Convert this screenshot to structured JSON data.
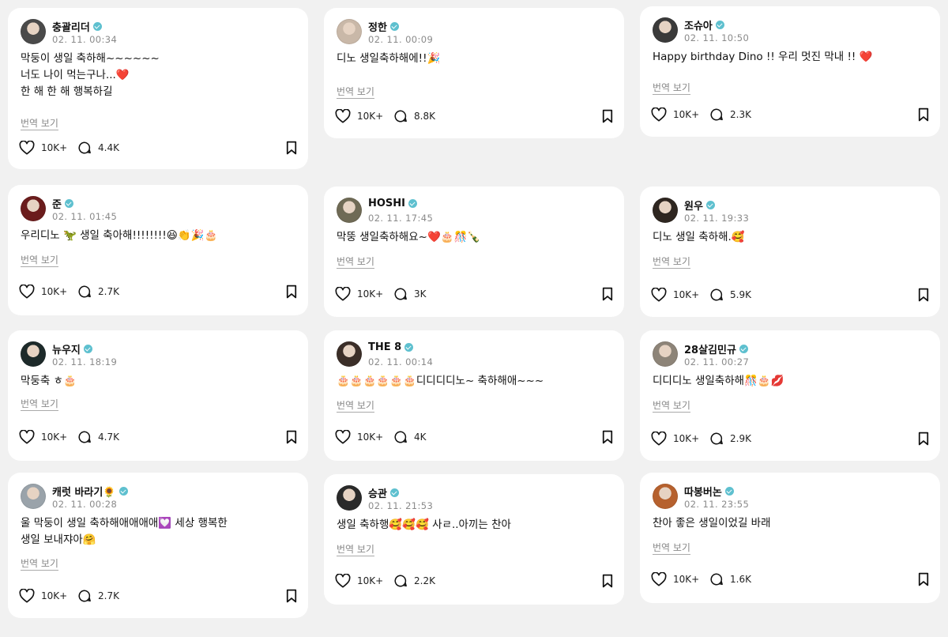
{
  "translate_label": "번역 보기",
  "accent_color": "#5ec0cf",
  "posts": [
    {
      "name": "충괄리더",
      "date": "02. 11. 00:34",
      "lines": [
        "막둥이 생일 축하해~~~~~~",
        "너도 나이 먹는구나...❤️",
        "한 해 한 해 행복하길"
      ],
      "likes": "10K+",
      "replies": "4.4K",
      "avatar": "#4a4a4a"
    },
    {
      "name": "정한",
      "date": "02. 11. 00:09",
      "lines": [
        "디노 생일축하해에!!🎉"
      ],
      "likes": "10K+",
      "replies": "8.8K",
      "avatar": "#c9b8a8"
    },
    {
      "name": "조슈아",
      "date": "02. 11. 10:50",
      "lines": [
        "Happy birthday Dino !! 우리 멋진 막내 !! ❤️"
      ],
      "likes": "10K+",
      "replies": "2.3K",
      "avatar": "#3a3a3a"
    },
    {
      "name": "준",
      "date": "02. 11. 01:45",
      "lines": [
        "우리디노 🦖 생일 축아해!!!!!!!!😆👏🎉🎂"
      ],
      "likes": "10K+",
      "replies": "2.7K",
      "avatar": "#6b1c1c"
    },
    {
      "name": "HOSHI",
      "date": "02. 11. 17:45",
      "lines": [
        "막뚱 생일축하해요~❤️🎂🎊🍾"
      ],
      "likes": "10K+",
      "replies": "3K",
      "avatar": "#6f6a55"
    },
    {
      "name": "원우",
      "date": "02. 11. 19:33",
      "lines": [
        "디노 생일 축하해.🥰"
      ],
      "likes": "10K+",
      "replies": "5.9K",
      "avatar": "#2e2620"
    },
    {
      "name": "뉴우지",
      "date": "02. 11. 18:19",
      "lines": [
        "막둥축 ㅎ🎂"
      ],
      "likes": "10K+",
      "replies": "4.7K",
      "avatar": "#1d2a2a"
    },
    {
      "name": "THE 8",
      "date": "02. 11. 00:14",
      "lines": [
        "🎂🎂🎂🎂🎂🎂디디디디노~ 축하해애~~~"
      ],
      "likes": "10K+",
      "replies": "4K",
      "avatar": "#3b2e28"
    },
    {
      "name": "28살김민규",
      "date": "02. 11. 00:27",
      "lines": [
        "디디디노 생일축하해🎊🎂💋"
      ],
      "likes": "10K+",
      "replies": "2.9K",
      "avatar": "#8d8478"
    },
    {
      "name": "캐럿 바라기🌻",
      "date": "02. 11. 00:28",
      "lines": [
        "울 막둥이 생일 축하해애애애애💟 세상 행복한",
        "생일 보내쟈아🤗"
      ],
      "likes": "10K+",
      "replies": "2.7K",
      "avatar": "#9aa3aa"
    },
    {
      "name": "승관",
      "date": "02. 11. 21:53",
      "lines": [
        "생일 축하행🥰🥰🥰 사ㄹ..아끼는 찬아"
      ],
      "likes": "10K+",
      "replies": "2.2K",
      "avatar": "#2a2a2a"
    },
    {
      "name": "따봉버논",
      "date": "02. 11. 23:55",
      "lines": [
        "찬아 좋은 생일이었길 바래"
      ],
      "likes": "10K+",
      "replies": "1.6K",
      "avatar": "#b6612e"
    }
  ]
}
